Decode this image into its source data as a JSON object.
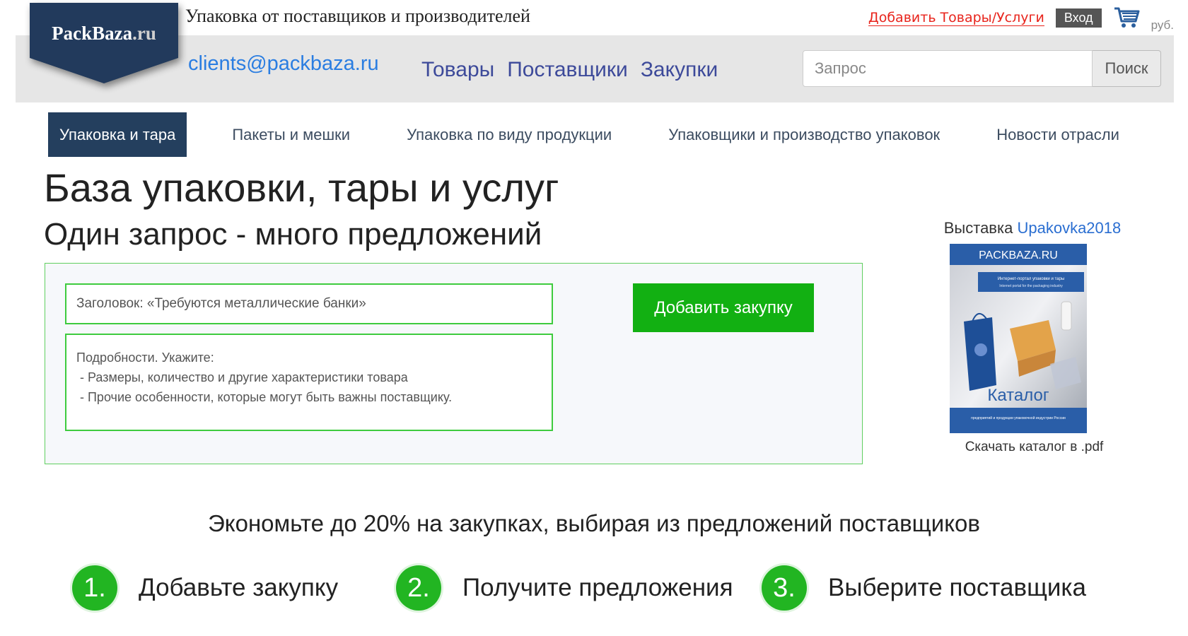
{
  "header": {
    "logo_main": "PackBaza",
    "logo_suffix": ".ru",
    "tagline": "Упаковка от поставщиков и производителей",
    "add_goods_link": "Добавить Товары/Услуги",
    "login_label": "Вход",
    "currency": "руб.",
    "email": "clients@packbaza.ru",
    "nav": [
      "Товары",
      "Поставщики",
      "Закупки"
    ],
    "search": {
      "placeholder": "Запрос",
      "button": "Поиск"
    }
  },
  "categories": [
    "Упаковка и тара",
    "Пакеты и мешки",
    "Упаковка по виду продукции",
    "Упаковщики и производство упаковок",
    "Новости отрасли"
  ],
  "main": {
    "title": "База упаковки, тары и услуг",
    "subtitle": "Один запрос - много предложений",
    "form": {
      "title_placeholder": "Заголовок: «Требуются металлические банки»",
      "details_line1": "Подробности. Укажите:",
      "details_line2": " - Размеры, количество и другие характеристики товара",
      "details_line3": " - Прочие особенности, которые могут быть важны поставщику.",
      "submit": "Добавить закупку"
    }
  },
  "sidebar": {
    "expo_prefix": "Выставка",
    "expo_link": "Upakovka2018",
    "catalog_brand": "PACKBAZA.RU",
    "catalog_subtitle": "Интернет-портал упаковки и тары",
    "catalog_subtitle_en": "Internet portal for the packaging industry",
    "catalog_title": "Каталог",
    "catalog_footer": "предприятий и продукции упаковочной индустрии России",
    "download_label": "Скачать каталог в .pdf"
  },
  "promo": {
    "text": "Экономьте до 20% на закупках, выбирая из предложений поставщиков",
    "steps": [
      {
        "num": "1.",
        "label": "Добавьте закупку"
      },
      {
        "num": "2.",
        "label": "Получите предложения"
      },
      {
        "num": "3.",
        "label": "Выберите поставщика"
      }
    ]
  },
  "colors": {
    "logo_bg": "#223a5c",
    "accent_green": "#12b012",
    "nav_blue": "#3d4a9a",
    "link_red": "#e8241c",
    "active_tab": "#243f5e"
  }
}
